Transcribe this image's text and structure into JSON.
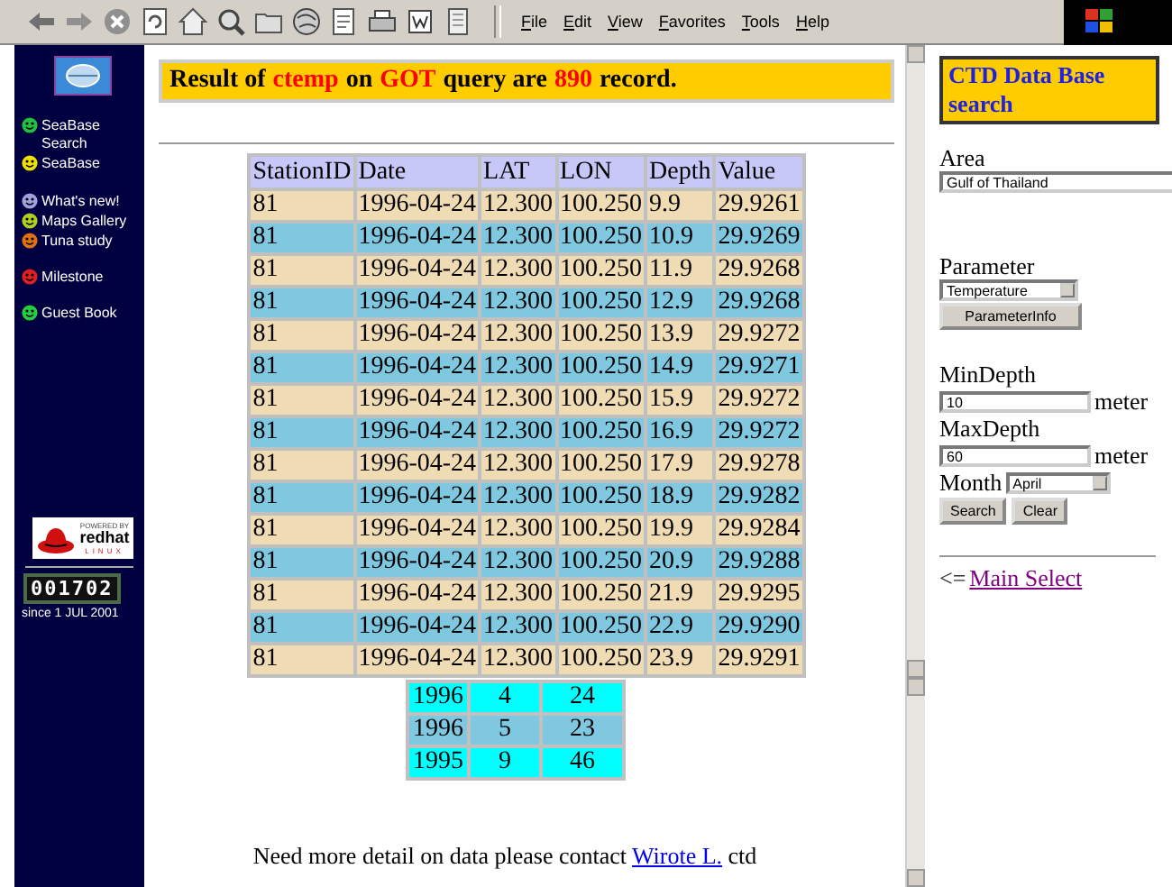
{
  "menu": [
    "File",
    "Edit",
    "View",
    "Favorites",
    "Tools",
    "Help"
  ],
  "sidebar": {
    "items": [
      {
        "label": "SeaBase Search",
        "color": "#20c040"
      },
      {
        "label": "SeaBase",
        "color": "#f0e000"
      },
      {
        "label": "What's new!",
        "color": "#a0a0e0"
      },
      {
        "label": "Maps Gallery",
        "color": "#b0d020"
      },
      {
        "label": "Tuna study",
        "color": "#e07010"
      },
      {
        "label": "Milestone",
        "color": "#e02020"
      },
      {
        "label": "Guest Book",
        "color": "#20d040"
      }
    ],
    "badge": {
      "tagline": "POWERED BY",
      "brand": "redhat",
      "product": "LINUX"
    },
    "counter": "001702",
    "since": "since 1 JUL 2001"
  },
  "result": [
    {
      "text": "Result of",
      "highlight": false
    },
    {
      "text": "ctemp",
      "highlight": true
    },
    {
      "text": "on",
      "highlight": false
    },
    {
      "text": "GOT",
      "highlight": true
    },
    {
      "text": "query are",
      "highlight": false
    },
    {
      "text": "890",
      "highlight": true
    },
    {
      "text": "record.",
      "highlight": false
    }
  ],
  "table": {
    "columns": [
      "StationID",
      "Date",
      "LAT",
      "LON",
      "Depth",
      "Value"
    ],
    "rows": [
      [
        "81",
        "1996-04-24",
        "12.300",
        "100.250",
        "9.9",
        "29.9261"
      ],
      [
        "81",
        "1996-04-24",
        "12.300",
        "100.250",
        "10.9",
        "29.9269"
      ],
      [
        "81",
        "1996-04-24",
        "12.300",
        "100.250",
        "11.9",
        "29.9268"
      ],
      [
        "81",
        "1996-04-24",
        "12.300",
        "100.250",
        "12.9",
        "29.9268"
      ],
      [
        "81",
        "1996-04-24",
        "12.300",
        "100.250",
        "13.9",
        "29.9272"
      ],
      [
        "81",
        "1996-04-24",
        "12.300",
        "100.250",
        "14.9",
        "29.9271"
      ],
      [
        "81",
        "1996-04-24",
        "12.300",
        "100.250",
        "15.9",
        "29.9272"
      ],
      [
        "81",
        "1996-04-24",
        "12.300",
        "100.250",
        "16.9",
        "29.9272"
      ],
      [
        "81",
        "1996-04-24",
        "12.300",
        "100.250",
        "17.9",
        "29.9278"
      ],
      [
        "81",
        "1996-04-24",
        "12.300",
        "100.250",
        "18.9",
        "29.9282"
      ],
      [
        "81",
        "1996-04-24",
        "12.300",
        "100.250",
        "19.9",
        "29.9284"
      ],
      [
        "81",
        "1996-04-24",
        "12.300",
        "100.250",
        "20.9",
        "29.9288"
      ],
      [
        "81",
        "1996-04-24",
        "12.300",
        "100.250",
        "21.9",
        "29.9295"
      ],
      [
        "81",
        "1996-04-24",
        "12.300",
        "100.250",
        "22.9",
        "29.9290"
      ],
      [
        "81",
        "1996-04-24",
        "12.300",
        "100.250",
        "23.9",
        "29.9291"
      ]
    ]
  },
  "summary": {
    "rows": [
      [
        "1996",
        "4",
        "24"
      ],
      [
        "1996",
        "5",
        "23"
      ],
      [
        "1995",
        "9",
        "46"
      ]
    ]
  },
  "footer": {
    "text": "Need more detail on data please contact",
    "link": "Wirote L.",
    "suffix": "ctd"
  },
  "search_form": {
    "title": "CTD Data Base search",
    "area_label": "Area",
    "area_value": "Gulf of Thailand",
    "parameter_label": "Parameter",
    "parameter_value": "Temperature",
    "info_button": "ParameterInfo",
    "min_label": "MinDepth",
    "min_value": "10",
    "min_unit": "meter",
    "max_label": "MaxDepth",
    "max_value": "60",
    "max_unit": "meter",
    "month_label": "Month",
    "month_value": "April",
    "search_button": "Search",
    "clear_button": "Clear",
    "back_prefix": "<=",
    "back_link": "Main Select"
  }
}
